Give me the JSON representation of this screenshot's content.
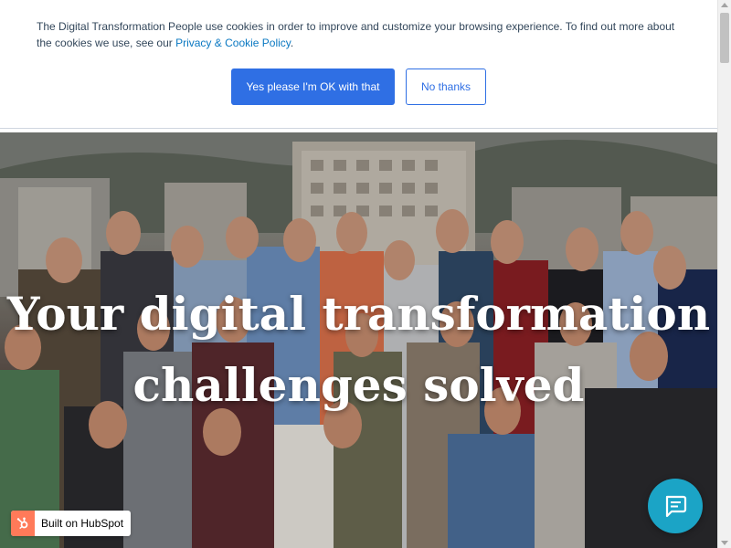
{
  "cookie_banner": {
    "text": "The Digital Transformation People use cookies in order to improve and customize your browsing experience. To find out more about the cookies we use, see our ",
    "link_label": "Privacy & Cookie Policy",
    "text_end": ".",
    "accept_label": "Yes please I'm OK with that",
    "decline_label": "No thanks"
  },
  "hero": {
    "title_line1": "Your digital transformation",
    "title_line2": "challenges solved"
  },
  "hubspot": {
    "label": "Built on HubSpot",
    "icon": "hubspot-sprocket-icon"
  },
  "chat": {
    "icon": "chat-bubble-icon"
  },
  "colors": {
    "accent": "#2f6fe4",
    "hubspot_orange": "#ff7a59",
    "chat_teal": "#1ba4c6",
    "link": "#0a78c2"
  }
}
